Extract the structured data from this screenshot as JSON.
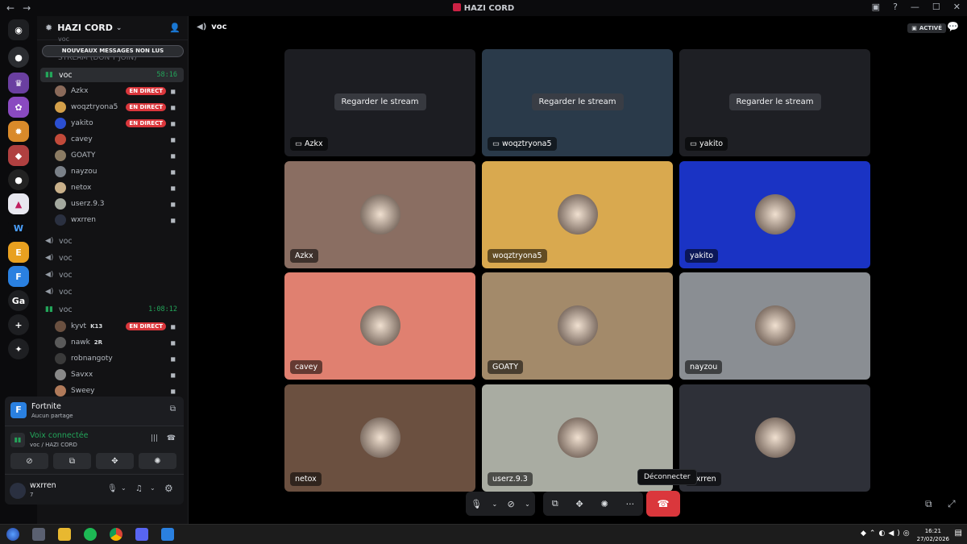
{
  "window": {
    "title": "HAZI CORD"
  },
  "server": {
    "name": "HAZI CORD"
  },
  "banner": {
    "unread": "NOUVEAUX MESSAGES NON LUS"
  },
  "scrolled": {
    "voc_top": "voc",
    "stream_label": "STREAM (DON'T JOIN)",
    "voc_bottom": "voc"
  },
  "channels": [
    {
      "name": "voc",
      "timer": "58:16",
      "active": true
    },
    {
      "name": "voc"
    },
    {
      "name": "voc"
    },
    {
      "name": "voc"
    },
    {
      "name": "voc"
    },
    {
      "name": "voc",
      "timer": "1:08:12"
    }
  ],
  "users_voc1": [
    {
      "name": "Azkx",
      "live": "EN DIRECT",
      "color": "#8a6a5a"
    },
    {
      "name": "woqztryona5",
      "live": "EN DIRECT",
      "color": "#d4a04a"
    },
    {
      "name": "yakito",
      "live": "EN DIRECT",
      "color": "#2b4fd1"
    },
    {
      "name": "cavey",
      "color": "#c24a3a"
    },
    {
      "name": "GOATY",
      "color": "#8b7b63"
    },
    {
      "name": "nayzou",
      "color": "#7a8088"
    },
    {
      "name": "netox",
      "color": "#c9b08a"
    },
    {
      "name": "userz.9.3",
      "color": "#a3a89e"
    },
    {
      "name": "wxrren",
      "color": "#2a3040"
    }
  ],
  "users_voc2": [
    {
      "name": "kyvt",
      "badge": "K13",
      "live": "EN DIRECT",
      "color": "#6a5040"
    },
    {
      "name": "nawk",
      "badge": "2R",
      "color": "#5a5a5a"
    },
    {
      "name": "robnangoty",
      "color": "#3a3a3a"
    },
    {
      "name": "Savxx",
      "color": "#888"
    },
    {
      "name": "Sweey",
      "color": "#b07a5a"
    }
  ],
  "activity": {
    "game": "Fortnite",
    "status": "Aucun partage"
  },
  "voice": {
    "status": "Voix connectée",
    "location": "voc / HAZI CORD"
  },
  "me": {
    "name": "wxrren",
    "sub": "7"
  },
  "main": {
    "channel": "voc",
    "badge": "ACTIVÉ"
  },
  "streams": [
    {
      "name": "Azkx",
      "watch": "Regarder le stream"
    },
    {
      "name": "woqztryona5",
      "watch": "Regarder le stream"
    },
    {
      "name": "yakito",
      "watch": "Regarder le stream"
    }
  ],
  "tiles": [
    {
      "name": "Azkx",
      "bg": "#8a6e62"
    },
    {
      "name": "woqztryona5",
      "bg": "#d9a94f"
    },
    {
      "name": "yakito",
      "bg": "#1a33c4"
    },
    {
      "name": "cavey",
      "bg": "#e08070"
    },
    {
      "name": "GOATY",
      "bg": "#a38a6a"
    },
    {
      "name": "nayzou",
      "bg": "#8a8e93"
    },
    {
      "name": "netox",
      "bg": "#6b5040"
    },
    {
      "name": "userz.9.3",
      "bg": "#a9aca2"
    },
    {
      "name": "wxrren",
      "bg": "#2e3038"
    }
  ],
  "tooltip": {
    "disconnect": "Déconnecter"
  },
  "taskbar": {
    "time": "16:21",
    "date": "27/02/2026"
  }
}
